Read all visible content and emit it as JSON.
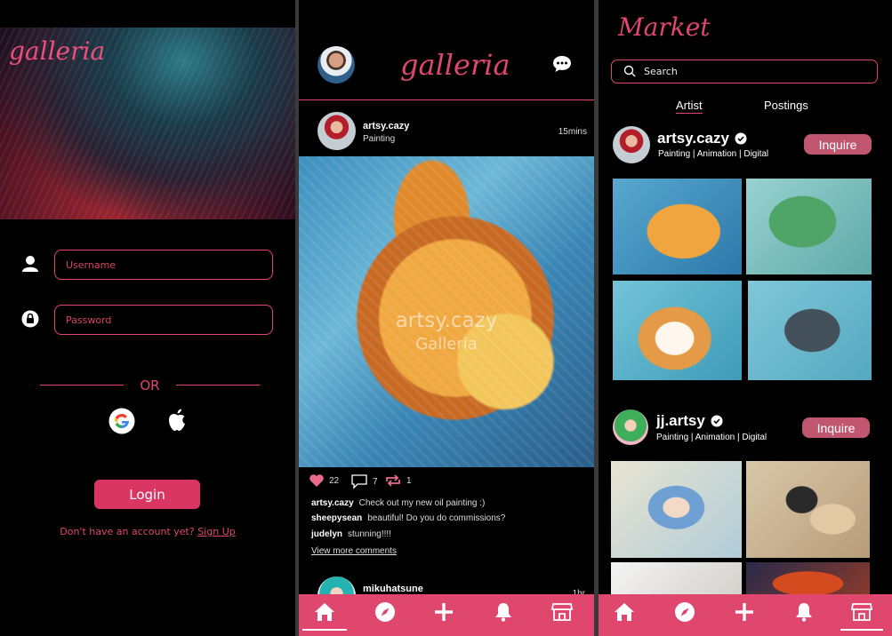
{
  "login": {
    "logo": "galleria",
    "username_placeholder": "Username",
    "password_placeholder": "Password",
    "or_label": "OR",
    "login_button": "Login",
    "signup_prompt": "Don't have an account yet?",
    "signup_link": "Sign Up"
  },
  "feed": {
    "logo": "galleria",
    "post": {
      "username": "artsy.cazy",
      "category": "Painting",
      "time": "15mins",
      "watermark_user": "artsy.cazy",
      "watermark_brand": "Galleria",
      "likes": "22",
      "comments": "7",
      "reposts": "1"
    },
    "comments": [
      {
        "user": "artsy.cazy",
        "text": "Check out my new oil painting :)"
      },
      {
        "user": "sheepysean",
        "text": "beautiful! Do you do commissions?"
      },
      {
        "user": "judelyn",
        "text": "stunning!!!!"
      }
    ],
    "view_more": "View more comments",
    "next_post": {
      "username": "mikuhatsune",
      "time": "1hr"
    }
  },
  "market": {
    "title": "Market",
    "search_placeholder": "Search",
    "tabs": [
      "Artist",
      "Postings"
    ],
    "artists": [
      {
        "name": "artsy.cazy",
        "tags": "Painting | Animation | Digital",
        "button": "Inquire"
      },
      {
        "name": "jj.artsy",
        "tags": "Painting | Animation | Digital",
        "button": "Inquire"
      }
    ]
  },
  "nav": {
    "icons": [
      "home-icon",
      "explore-icon",
      "add-icon",
      "notifications-icon",
      "market-icon"
    ]
  },
  "colors": {
    "accent": "#e0476f",
    "button": "#d93663",
    "inquire": "#c0566f",
    "background": "#000000"
  }
}
